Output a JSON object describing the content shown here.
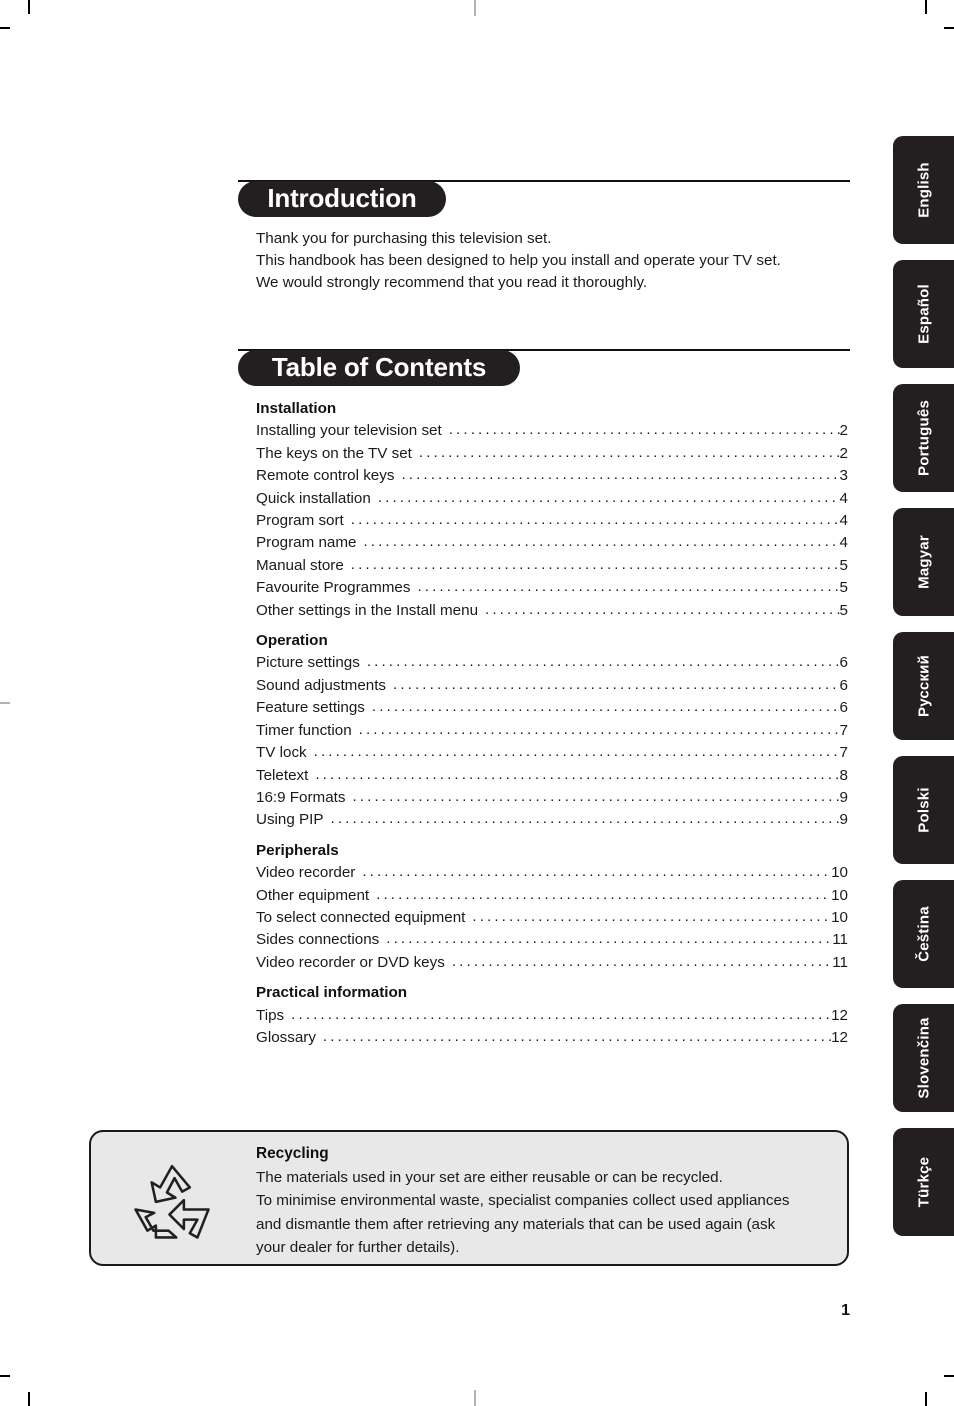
{
  "document": {
    "page_number": "1"
  },
  "introduction": {
    "heading": "Introduction",
    "paragraph_lines": [
      "Thank you for purchasing this television set.",
      "This handbook has been designed to help you install and operate your TV set.",
      "We would strongly recommend that you read it thoroughly."
    ]
  },
  "table_of_contents": {
    "heading": "Table of Contents",
    "groups": [
      {
        "title": "Installation",
        "entries": [
          {
            "label": "Installing your television set",
            "page": "2"
          },
          {
            "label": "The keys on the TV set",
            "page": "2"
          },
          {
            "label": "Remote control keys",
            "page": "3"
          },
          {
            "label": "Quick installation",
            "page": "4"
          },
          {
            "label": "Program sort",
            "page": "4"
          },
          {
            "label": "Program name",
            "page": "4"
          },
          {
            "label": "Manual store",
            "page": "5"
          },
          {
            "label": "Favourite Programmes",
            "page": "5"
          },
          {
            "label": "Other settings in the Install menu",
            "page": "5"
          }
        ]
      },
      {
        "title": "Operation",
        "entries": [
          {
            "label": "Picture settings",
            "page": "6"
          },
          {
            "label": "Sound adjustments",
            "page": "6"
          },
          {
            "label": "Feature settings",
            "page": "6"
          },
          {
            "label": "Timer function",
            "page": "7"
          },
          {
            "label": "TV lock",
            "page": "7"
          },
          {
            "label": "Teletext",
            "page": "8"
          },
          {
            "label": "16:9 Formats",
            "page": "9"
          },
          {
            "label": "Using PIP",
            "page": "9"
          }
        ]
      },
      {
        "title": "Peripherals",
        "entries": [
          {
            "label": "Video recorder",
            "page": "10"
          },
          {
            "label": "Other equipment",
            "page": "10"
          },
          {
            "label": "To select connected equipment",
            "page": "10"
          },
          {
            "label": "Sides connections",
            "page": "11"
          },
          {
            "label": "Video recorder or DVD keys",
            "page": "11"
          }
        ]
      },
      {
        "title": "Practical information",
        "entries": [
          {
            "label": "Tips",
            "page": "12"
          },
          {
            "label": "Glossary",
            "page": "12"
          }
        ]
      }
    ]
  },
  "recycling": {
    "icon": "recycling-icon",
    "title": "Recycling",
    "lines": [
      "The materials used in your set are either reusable or can be recycled.",
      "To minimise environmental waste, specialist companies collect used appliances",
      "and dismantle them after retrieving any materials that can be used again (ask",
      "your dealer for further details)."
    ]
  },
  "language_tabs": [
    {
      "label": "English"
    },
    {
      "label": "Español"
    },
    {
      "label": "Português"
    },
    {
      "label": "Magyar"
    },
    {
      "label": "Русский"
    },
    {
      "label": "Polski"
    },
    {
      "label": "Čeština"
    },
    {
      "label": "Slovenčina"
    },
    {
      "label": "Türkçe"
    }
  ],
  "colors": {
    "ink": "#231f20",
    "panel": "#e8e8e8",
    "crop_mark": "#000000",
    "crop_mark_light": "#b3b3b3"
  }
}
